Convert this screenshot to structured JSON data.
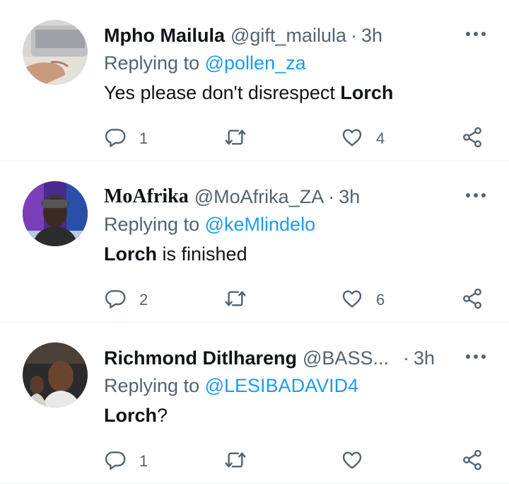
{
  "tweets": [
    {
      "name": "Mpho Mailula",
      "handle": "@gift_mailula",
      "dot": "·",
      "time": "3h",
      "replying_label": "Replying to",
      "replying_to": "@pollen_za",
      "text_before": "Yes please don't disrespect ",
      "text_bold": "Lorch",
      "text_after": "",
      "reply_count": "1",
      "retweet_count": "",
      "like_count": "4"
    },
    {
      "name": "MoAfrika",
      "handle": "@MoAfrika_ZA",
      "dot": "·",
      "time": "3h",
      "replying_label": "Replying to",
      "replying_to": "@keMlindelo",
      "text_before": "",
      "text_bold": "Lorch",
      "text_after": " is finished",
      "reply_count": "2",
      "retweet_count": "",
      "like_count": "6"
    },
    {
      "name": "Richmond Ditlhareng",
      "handle": "@BASS...",
      "dot": "·",
      "time": "3h",
      "replying_label": "Replying to",
      "replying_to": "@LESIBADAVID4",
      "text_before": "",
      "text_bold": "Lorch",
      "text_after": "?",
      "reply_count": "1",
      "retweet_count": "",
      "like_count": ""
    }
  ],
  "icons": {
    "reply": "reply-icon",
    "retweet": "retweet-icon",
    "like": "heart-icon",
    "share": "share-icon",
    "more": "more-options-icon"
  },
  "colors": {
    "text": "#0f1419",
    "secondary": "#536471",
    "link": "#1d9bf0",
    "divider": "#eff3f4"
  }
}
